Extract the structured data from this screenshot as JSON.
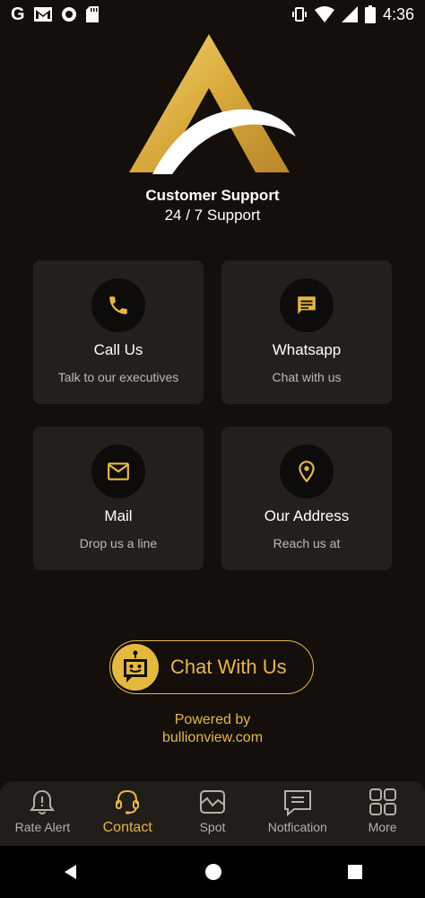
{
  "status_bar": {
    "time": "4:36",
    "google_letter": "G",
    "icons": [
      "gmail-icon",
      "record-icon",
      "sd-card-icon",
      "vibrate-icon",
      "wifi-icon",
      "signal-icon",
      "battery-icon"
    ]
  },
  "header": {
    "title": "Customer Support",
    "subtitle": "24 / 7 Support"
  },
  "cards": [
    {
      "title": "Call Us",
      "subtitle": "Talk to our executives",
      "icon": "phone-icon"
    },
    {
      "title": "Whatsapp",
      "subtitle": "Chat with us",
      "icon": "chat-message-icon"
    },
    {
      "title": "Mail",
      "subtitle": "Drop us a line",
      "icon": "mail-icon"
    },
    {
      "title": "Our Address",
      "subtitle": "Reach us at",
      "icon": "location-pin-icon"
    }
  ],
  "chat_button": {
    "label": "Chat With Us",
    "icon": "robot-icon"
  },
  "powered": {
    "line1": "Powered by",
    "line2": "bullionview.com"
  },
  "bottom_nav": {
    "active_index": 1,
    "items": [
      {
        "label": "Rate Alert",
        "icon": "bell-alert-icon"
      },
      {
        "label": "Contact",
        "icon": "headset-icon"
      },
      {
        "label": "Spot",
        "icon": "spot-chart-icon"
      },
      {
        "label": "Notfication",
        "icon": "notification-message-icon"
      },
      {
        "label": "More",
        "icon": "grid-more-icon"
      }
    ]
  },
  "colors": {
    "accent": "#e5b93d",
    "background": "#140f0b",
    "card": "#23201c",
    "nav": "#211d19"
  }
}
